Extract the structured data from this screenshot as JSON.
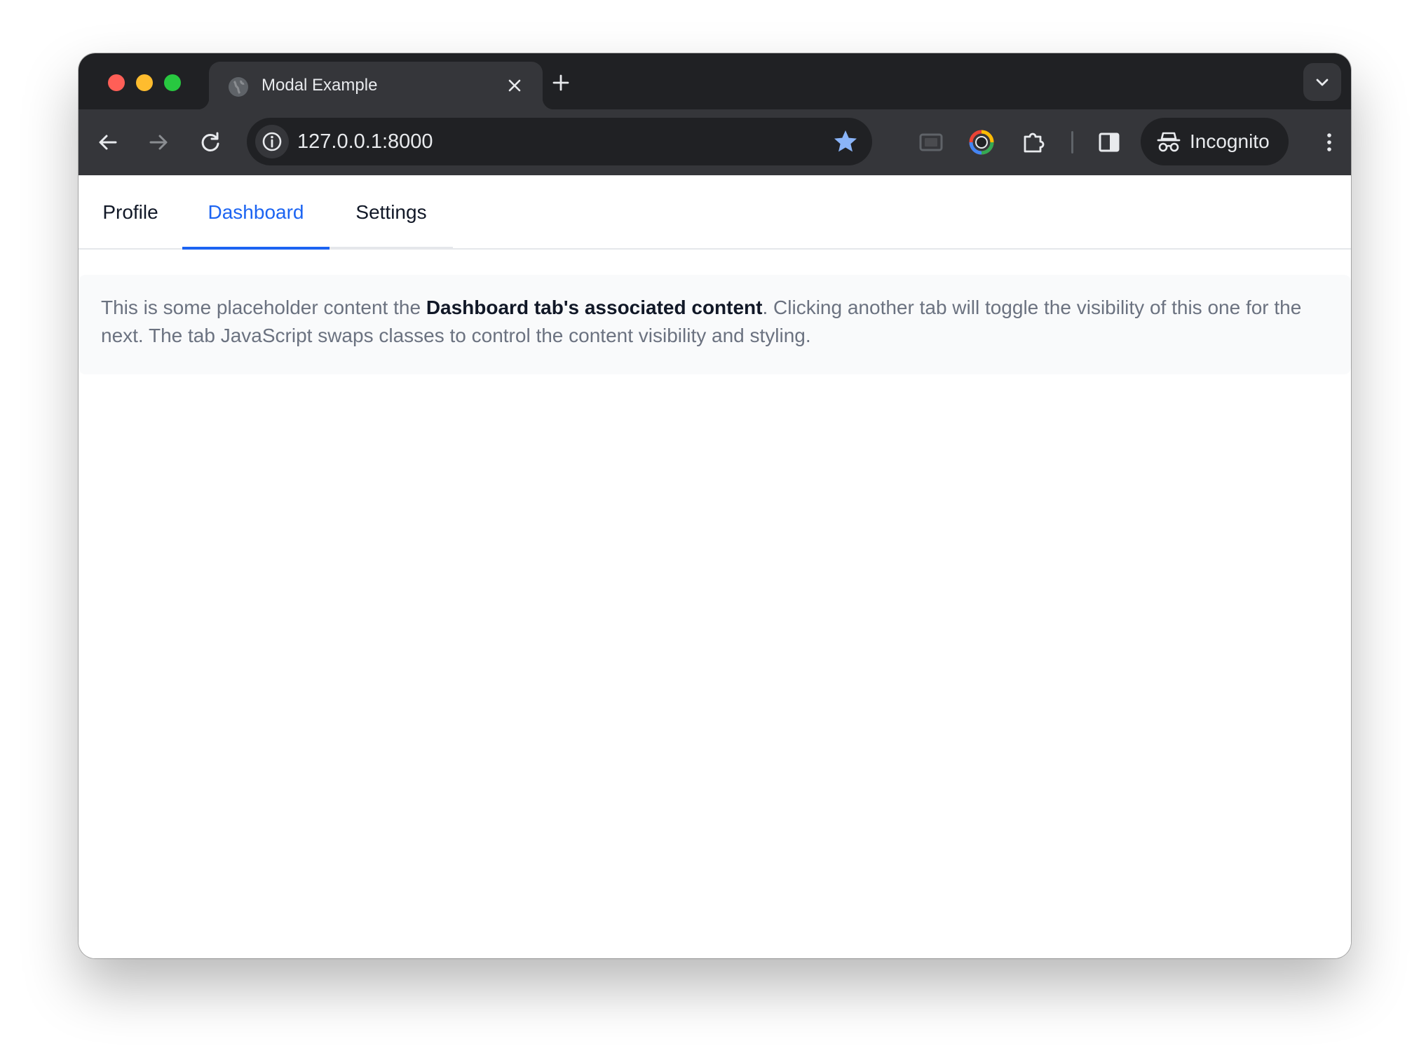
{
  "browser": {
    "tab_title": "Modal Example",
    "url": "127.0.0.1:8000",
    "profile_label": "Incognito",
    "colors": {
      "frame": "#202124",
      "toolbar": "#35363a",
      "bookmark_star": "#8ab4f8"
    }
  },
  "page": {
    "tabs": [
      {
        "label": "Profile",
        "active": false
      },
      {
        "label": "Dashboard",
        "active": true
      },
      {
        "label": "Settings",
        "active": false
      }
    ],
    "active_color": "#1c64f2",
    "content": {
      "before": "This is some placeholder content the ",
      "bold": "Dashboard tab's associated content",
      "after": ". Clicking another tab will toggle the visibility of this one for the next. The tab JavaScript swaps classes to control the content visibility and styling."
    }
  }
}
